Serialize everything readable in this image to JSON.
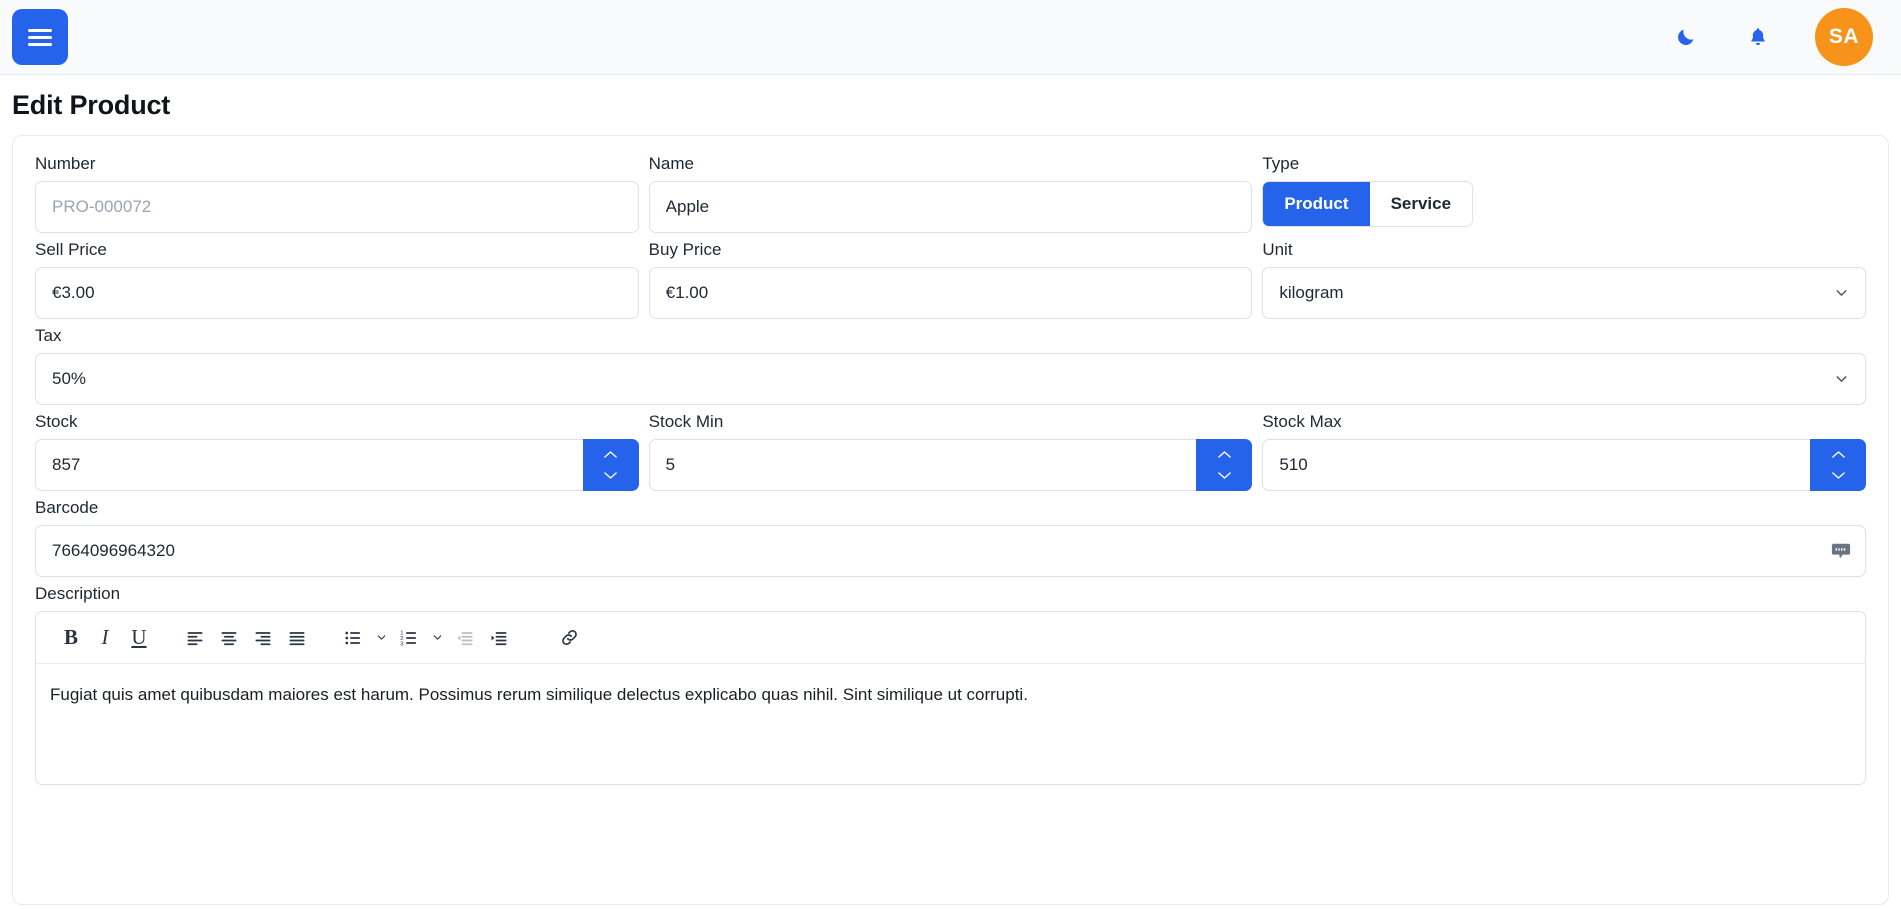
{
  "header": {
    "menu_icon": "hamburger-menu-icon",
    "dark_mode_icon": "moon-icon",
    "notifications_icon": "bell-icon",
    "avatar_initials": "SA",
    "avatar_color": "#f7931a",
    "accent_color": "#2563eb"
  },
  "page": {
    "title": "Edit Product"
  },
  "form": {
    "number": {
      "label": "Number",
      "value": "",
      "placeholder": "PRO-000072"
    },
    "name": {
      "label": "Name",
      "value": "Apple",
      "placeholder": ""
    },
    "type": {
      "label": "Type",
      "options": [
        "Product",
        "Service"
      ],
      "selected": "Product"
    },
    "sell_price": {
      "label": "Sell Price",
      "value": "€3.00"
    },
    "buy_price": {
      "label": "Buy Price",
      "value": "€1.00"
    },
    "unit": {
      "label": "Unit",
      "value": "kilogram"
    },
    "tax": {
      "label": "Tax",
      "value": "50%"
    },
    "stock": {
      "label": "Stock",
      "value": "857"
    },
    "stock_min": {
      "label": "Stock Min",
      "value": "5"
    },
    "stock_max": {
      "label": "Stock Max",
      "value": "510"
    },
    "barcode": {
      "label": "Barcode",
      "value": "7664096964320",
      "action_icon": "barcode-scan-icon"
    },
    "description": {
      "label": "Description",
      "text": "Fugiat quis amet quibusdam maiores est harum. Possimus rerum similique delectus explicabo quas nihil. Sint similique ut corrupti.",
      "toolbar": {
        "bold": "B",
        "italic": "I",
        "underline": "U",
        "align_left": "align-left-icon",
        "align_center": "align-center-icon",
        "align_right": "align-right-icon",
        "align_justify": "align-justify-icon",
        "bullet_list": "bullet-list-icon",
        "bullet_list_more": "chevron-down-icon",
        "numbered_list": "numbered-list-icon",
        "numbered_list_more": "chevron-down-icon",
        "outdent": "outdent-icon",
        "indent": "indent-icon",
        "link": "link-icon"
      }
    }
  }
}
